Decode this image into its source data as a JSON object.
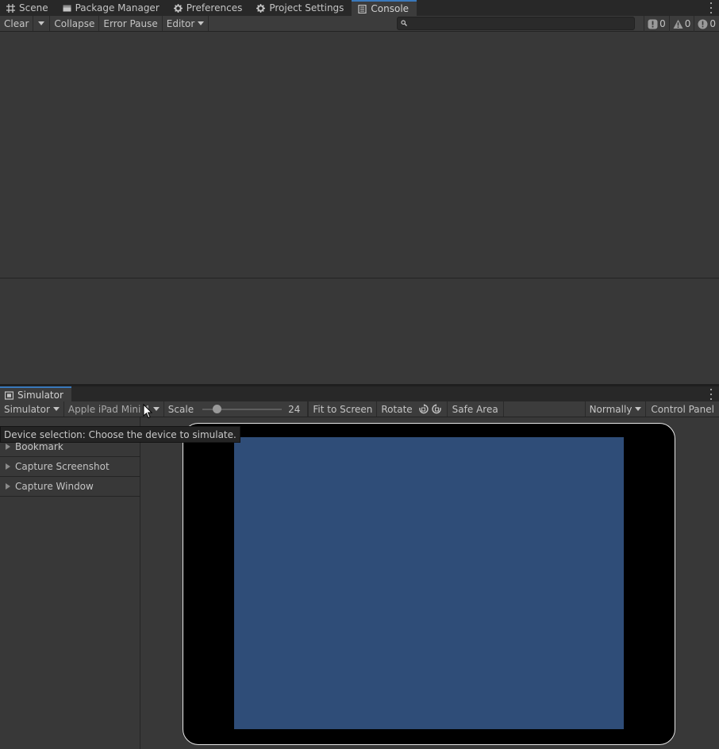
{
  "top_tabs": [
    {
      "label": "Scene",
      "icon": "grid-icon"
    },
    {
      "label": "Package Manager",
      "icon": "package-icon"
    },
    {
      "label": "Preferences",
      "icon": "gear-icon"
    },
    {
      "label": "Project Settings",
      "icon": "gear-icon"
    },
    {
      "label": "Console",
      "icon": "console-icon",
      "active": true
    }
  ],
  "console_toolbar": {
    "clear": "Clear",
    "collapse": "Collapse",
    "error_pause": "Error Pause",
    "editor": "Editor",
    "search_placeholder": "",
    "log_count": "0",
    "warning_count": "0",
    "error_count": "0"
  },
  "simulator_tab": {
    "label": "Simulator",
    "icon": "simulator-icon"
  },
  "simulator_toolbar": {
    "mode": "Simulator",
    "device": "Apple iPad Mini 4",
    "scale_label": "Scale",
    "scale_value": "24",
    "scale_fraction": 0.18,
    "fit_to_screen": "Fit to Screen",
    "rotate": "Rotate",
    "safe_area": "Safe Area",
    "normally": "Normally",
    "control_panel": "Control Panel"
  },
  "left_panel": {
    "items": [
      "Bookmark",
      "Capture Screenshot",
      "Capture Window"
    ]
  },
  "tooltip": "Device selection: Choose the device to simulate.",
  "colors": {
    "accent": "#3a79bb",
    "screen": "#2f4d78",
    "background": "#383838"
  }
}
